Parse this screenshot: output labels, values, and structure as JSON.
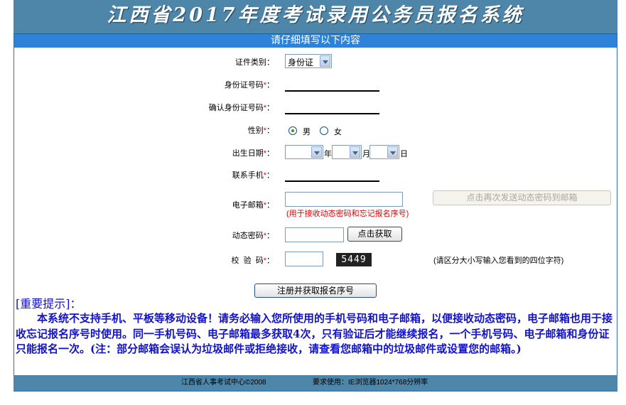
{
  "header": {
    "title": "江西省2017年度考试录用公务员报名系统"
  },
  "subheader": {
    "text": "请仔细填写以下内容"
  },
  "form": {
    "id_type": {
      "label": "证件类别：",
      "value": "身份证"
    },
    "id_number": {
      "label": "身份证号码",
      "required": "*",
      "colon": "："
    },
    "id_confirm": {
      "label": "确认身份证号码",
      "required": "*",
      "colon": "："
    },
    "gender": {
      "label": "性别",
      "required": "*",
      "colon": "：",
      "male": "男",
      "female": "女",
      "selected": "男"
    },
    "birth": {
      "label": "出生日期",
      "required": "*",
      "colon": "：",
      "year_unit": "年",
      "month_unit": "月",
      "day_unit": "日"
    },
    "mobile": {
      "label": "联系手机",
      "required": "*",
      "colon": "："
    },
    "email": {
      "label": "电子邮箱",
      "required": "*",
      "colon": "：",
      "hint": "(用于接收动态密码和忘记报名序号)",
      "resend_button": "点击再次发送动态密码到邮箱"
    },
    "otp": {
      "label": "动态密码",
      "required": "*",
      "colon": "：",
      "get_button": "点击获取"
    },
    "captcha": {
      "label": "校  验  码",
      "required": "*",
      "colon": "：",
      "image_text": "5449",
      "hint": "(请区分大小写输入您看到的四位字符)"
    },
    "submit_button": "注册并获取报名序号"
  },
  "notice": {
    "title": "[重要提示]：",
    "body": "本系统不支持手机、平板等移动设备！请务必输入您所使用的手机号码和电子邮箱，以便接收动态密码，电子邮箱也用于接收忘记报名序号时使用。同一手机号码、电子邮箱最多获取4次，只有验证后才能继续报名，一个手机号码、电子邮箱和身份证只能报名一次。(注：部分邮箱会误认为垃圾邮件或拒绝接收，请查看您邮箱中的垃圾邮件或设置您的邮箱。)"
  },
  "footer": {
    "copyright": "江西省人事考试中心©2008",
    "requirement": "要求使用：IE浏览器1024*768分辨率"
  },
  "colors": {
    "banner": "#4d86a8",
    "subheader": "#2e83d8",
    "notice": "#1212c8",
    "required": "#e00000"
  }
}
